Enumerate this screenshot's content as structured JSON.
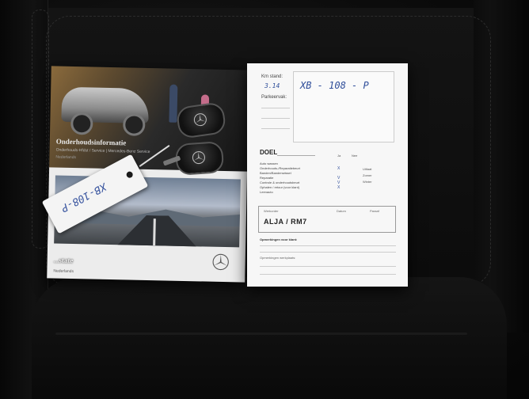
{
  "booklet": {
    "title": "Onderhoudsinformatie",
    "subtitle": "Onderhouds-Hfdst / Service | Mercedes-Benz Service",
    "lang": "Nederlands",
    "title_bottom": "...state",
    "lang_bottom": "Nederlands"
  },
  "tag": {
    "text": "XB-108-P"
  },
  "form": {
    "km_label": "Km stand:",
    "km_value": "3.14",
    "park_label": "Parkeervak:",
    "plate": "XB - 108 - P",
    "doel_label": "DOEL",
    "col_ja": "Ja",
    "col_nee": "Nee",
    "items": [
      "Auto wassen",
      "Onderhouds-/Reparatiebeurt",
      "Banden/Bandenwissel",
      "Reparatie",
      "Controle & onderhoudsbeurt",
      "Ophalen / retour (voor klant)",
      "Leenauto"
    ],
    "checks": [
      "",
      "X",
      "",
      "V",
      "V",
      "X",
      ""
    ],
    "right_items": [
      "Uitlaat",
      "Zomer",
      "Winter"
    ],
    "sign_label1": "Werkorder",
    "sign_label2": "Datum",
    "sign_label3": "Paraaf",
    "sign_value": "ALJA / RM7",
    "remark_label": "Opmerkingen voor klant:",
    "remark_label2": "Opmerkingen werkplaats:"
  }
}
